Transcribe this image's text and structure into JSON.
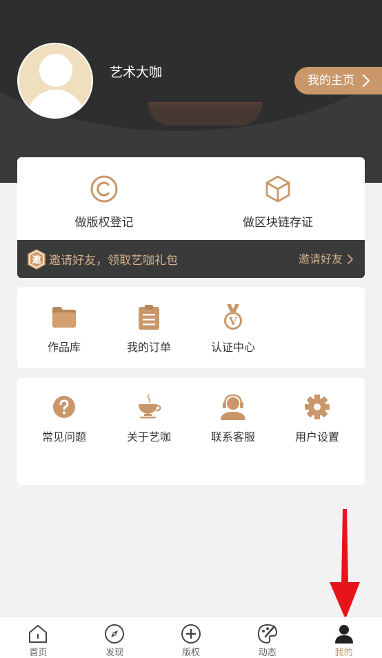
{
  "profile": {
    "username": "艺术大咖",
    "home_button": "我的主页"
  },
  "actions": [
    {
      "label": "做版权登记",
      "icon": "copyright-icon"
    },
    {
      "label": "做区块链存证",
      "icon": "cube-icon"
    }
  ],
  "invite": {
    "badge": "邀",
    "text": "邀请好友，领取艺咖礼包",
    "link": "邀请好友"
  },
  "section1": [
    {
      "label": "作品库",
      "icon": "folder-icon"
    },
    {
      "label": "我的订单",
      "icon": "clipboard-icon"
    },
    {
      "label": "认证中心",
      "icon": "medal-icon"
    }
  ],
  "section2": [
    {
      "label": "常见问题",
      "icon": "question-icon"
    },
    {
      "label": "关于艺咖",
      "icon": "coffee-cup-icon"
    },
    {
      "label": "联系客服",
      "icon": "headset-agent-icon"
    },
    {
      "label": "用户设置",
      "icon": "gear-icon"
    }
  ],
  "tabbar": [
    {
      "label": "首页",
      "icon": "home-icon"
    },
    {
      "label": "发现",
      "icon": "compass-icon"
    },
    {
      "label": "版权",
      "icon": "plus-circle-icon"
    },
    {
      "label": "动态",
      "icon": "palette-icon"
    },
    {
      "label": "我的",
      "icon": "user-icon",
      "active": true
    }
  ],
  "colors": {
    "accent": "#c9976a",
    "dark": "#3a3a3a",
    "annotation": "#e8141c"
  }
}
